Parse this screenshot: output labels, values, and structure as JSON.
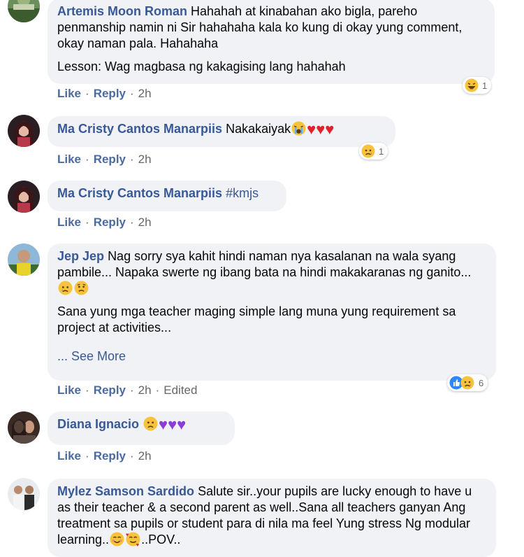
{
  "comments": [
    {
      "author": "Artemis Moon Roman",
      "text": "Hahahah at kinabahan ako bigla, pareho penmanship namin ni Sir hahahaha kala ko kung di okay yung comment, okay naman pala. Hahahaha",
      "text2": "Lesson: Wag magbasa ng kakagising lang hahahah",
      "like": "Like",
      "reply": "Reply",
      "time": "2h",
      "reaction_count": "1",
      "reaction_icons": [
        "laugh-emoji"
      ]
    },
    {
      "author": "Ma Cristy Cantos Manarpiis",
      "text": "Nakakaiyak",
      "emojis": [
        "loudly-crying-emoji",
        "red-heart",
        "red-heart",
        "red-heart"
      ],
      "like": "Like",
      "reply": "Reply",
      "time": "2h",
      "reaction_count": "1",
      "reaction_icons": [
        "sad-emoji"
      ]
    },
    {
      "author": "Ma Cristy Cantos Manarpiis",
      "text": "#kmjs",
      "like": "Like",
      "reply": "Reply",
      "time": "2h"
    },
    {
      "author": "Jep Jep",
      "text": "Nag sorry sya kahit hindi naman nya kasalanan na wala syang pambile... Napaka swerte ng ibang bata na hindi makakaranas ng ganito... ",
      "emojis": [
        "crying-emoji",
        "sad-emoji"
      ],
      "text2": "Sana yung mga teacher maging simple lang muna yung requirement sa project at activities...",
      "see_more": "... See More",
      "like": "Like",
      "reply": "Reply",
      "time": "2h",
      "edited": "Edited",
      "reaction_count": "6",
      "reaction_icons": [
        "like-icon",
        "sad-emoji"
      ]
    },
    {
      "author": "Diana Ignacio",
      "emojis": [
        "frowning-emoji",
        "purple-heart",
        "purple-heart",
        "purple-heart"
      ],
      "like": "Like",
      "reply": "Reply",
      "time": "2h"
    },
    {
      "author": "Mylez Samson Sardido",
      "text": "Salute sir..your pupils are lucky enough to have u as their teacher & a second parent as well..Sana all teachers ganyan Ang treatment sa pupils or student para di nila ma feel Yung stress Ng modular learning..",
      "emojis": [
        "smiling-emoji",
        "smiling-hearts-emoji"
      ],
      "text_end": "..POV.."
    }
  ],
  "separator": "·",
  "colors": {
    "author": "#385898",
    "bubble": "#f0f2f5",
    "muted": "#65676b",
    "heart_red": "#e0212e",
    "heart_purple": "#8c3bd7"
  }
}
